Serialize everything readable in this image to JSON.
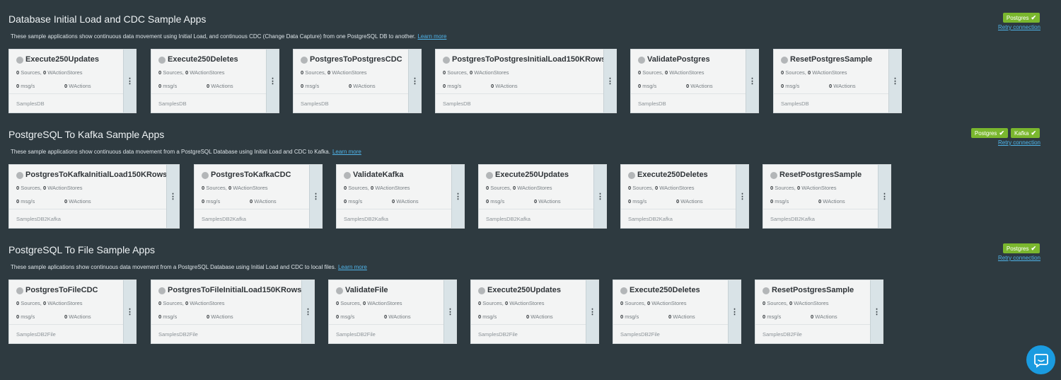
{
  "sections": [
    {
      "title": "Database Initial Load and CDC Sample Apps",
      "description": "These sample applications show continuous data movement using Initial Load, and continuous CDC (Change Data Capture) from one PostgreSQL DB to another.",
      "learn_more": "Learn more",
      "badges": [
        "Postgres"
      ],
      "retry": "Retry connection",
      "apps": [
        {
          "name": "Execute250Updates",
          "sources": "0",
          "sources_label": "Sources,",
          "stores": "0",
          "stores_label": "WActionStores",
          "msg": "0",
          "msg_label": "msg/s",
          "wactions": "0",
          "wactions_label": "WActions",
          "db": "SamplesDB"
        },
        {
          "name": "Execute250Deletes",
          "sources": "0",
          "sources_label": "Sources,",
          "stores": "0",
          "stores_label": "WActionStores",
          "msg": "0",
          "msg_label": "msg/s",
          "wactions": "0",
          "wactions_label": "WActions",
          "db": "SamplesDB"
        },
        {
          "name": "PostgresToPostgresCDC",
          "sources": "0",
          "sources_label": "Sources,",
          "stores": "0",
          "stores_label": "WActionStores",
          "msg": "0",
          "msg_label": "msg/s",
          "wactions": "0",
          "wactions_label": "WActions",
          "db": "SamplesDB"
        },
        {
          "name": "PostgresToPostgresInitialLoad150KRows",
          "sources": "0",
          "sources_label": "Sources,",
          "stores": "0",
          "stores_label": "WActionStores",
          "msg": "0",
          "msg_label": "msg/s",
          "wactions": "0",
          "wactions_label": "WActions",
          "db": "SamplesDB"
        },
        {
          "name": "ValidatePostgres",
          "sources": "0",
          "sources_label": "Sources,",
          "stores": "0",
          "stores_label": "WActionStores",
          "msg": "0",
          "msg_label": "msg/s",
          "wactions": "0",
          "wactions_label": "WActions",
          "db": "SamplesDB"
        },
        {
          "name": "ResetPostgresSample",
          "sources": "0",
          "sources_label": "Sources,",
          "stores": "0",
          "stores_label": "WActionStores",
          "msg": "0",
          "msg_label": "msg/s",
          "wactions": "0",
          "wactions_label": "WActions",
          "db": "SamplesDB"
        }
      ]
    },
    {
      "title": "PostgreSQL To Kafka Sample Apps",
      "description": "These sample applications show continuous data movement from a PostgreSQL Database using Initial Load and CDC to Kafka.",
      "learn_more": "Learn more",
      "badges": [
        "Postgres",
        "Kafka"
      ],
      "retry": "Retry connection",
      "apps": [
        {
          "name": "PostgresToKafkaInitialLoad150KRows",
          "sources": "0",
          "sources_label": "Sources,",
          "stores": "0",
          "stores_label": "WActionStores",
          "msg": "0",
          "msg_label": "msg/s",
          "wactions": "0",
          "wactions_label": "WActions",
          "db": "SamplesDB2Kafka"
        },
        {
          "name": "PostgresToKafkaCDC",
          "sources": "0",
          "sources_label": "Sources,",
          "stores": "0",
          "stores_label": "WActionStores",
          "msg": "0",
          "msg_label": "msg/s",
          "wactions": "0",
          "wactions_label": "WActions",
          "db": "SamplesDB2Kafka"
        },
        {
          "name": "ValidateKafka",
          "sources": "0",
          "sources_label": "Sources,",
          "stores": "0",
          "stores_label": "WActionStores",
          "msg": "0",
          "msg_label": "msg/s",
          "wactions": "0",
          "wactions_label": "WActions",
          "db": "SamplesDB2Kafka"
        },
        {
          "name": "Execute250Updates",
          "sources": "0",
          "sources_label": "Sources,",
          "stores": "0",
          "stores_label": "WActionStores",
          "msg": "0",
          "msg_label": "msg/s",
          "wactions": "0",
          "wactions_label": "WActions",
          "db": "SamplesDB2Kafka"
        },
        {
          "name": "Execute250Deletes",
          "sources": "0",
          "sources_label": "Sources,",
          "stores": "0",
          "stores_label": "WActionStores",
          "msg": "0",
          "msg_label": "msg/s",
          "wactions": "0",
          "wactions_label": "WActions",
          "db": "SamplesDB2Kafka"
        },
        {
          "name": "ResetPostgresSample",
          "sources": "0",
          "sources_label": "Sources,",
          "stores": "0",
          "stores_label": "WActionStores",
          "msg": "0",
          "msg_label": "msg/s",
          "wactions": "0",
          "wactions_label": "WActions",
          "db": "SamplesDB2Kafka"
        }
      ]
    },
    {
      "title": "PostgreSQL To File Sample Apps",
      "description": "These sample aplications show continuous data movement from a PostgreSQL Database using Initial Load and CDC to local files.",
      "learn_more": "Learn more",
      "badges": [
        "Postgres"
      ],
      "retry": "Retry connection",
      "apps": [
        {
          "name": "PostgresToFileCDC",
          "sources": "0",
          "sources_label": "Sources,",
          "stores": "0",
          "stores_label": "WActionStores",
          "msg": "0",
          "msg_label": "msg/s",
          "wactions": "0",
          "wactions_label": "WActions",
          "db": "SamplesDB2File"
        },
        {
          "name": "PostgresToFileInitialLoad150KRows",
          "sources": "0",
          "sources_label": "Sources,",
          "stores": "0",
          "stores_label": "WActionStores",
          "msg": "0",
          "msg_label": "msg/s",
          "wactions": "0",
          "wactions_label": "WActions",
          "db": "SamplesDB2File"
        },
        {
          "name": "ValidateFile",
          "sources": "0",
          "sources_label": "Sources,",
          "stores": "0",
          "stores_label": "WActionStores",
          "msg": "0",
          "msg_label": "msg/s",
          "wactions": "0",
          "wactions_label": "WActions",
          "db": "SamplesDB2File"
        },
        {
          "name": "Execute250Updates",
          "sources": "0",
          "sources_label": "Sources,",
          "stores": "0",
          "stores_label": "WActionStores",
          "msg": "0",
          "msg_label": "msg/s",
          "wactions": "0",
          "wactions_label": "WActions",
          "db": "SamplesDB2File"
        },
        {
          "name": "Execute250Deletes",
          "sources": "0",
          "sources_label": "Sources,",
          "stores": "0",
          "stores_label": "WActionStores",
          "msg": "0",
          "msg_label": "msg/s",
          "wactions": "0",
          "wactions_label": "WActions",
          "db": "SamplesDB2File"
        },
        {
          "name": "ResetPostgresSample",
          "sources": "0",
          "sources_label": "Sources,",
          "stores": "0",
          "stores_label": "WActionStores",
          "msg": "0",
          "msg_label": "msg/s",
          "wactions": "0",
          "wactions_label": "WActions",
          "db": "SamplesDB2File"
        }
      ]
    }
  ],
  "icons": {
    "status": "status-dot-icon",
    "menu": "kebab-menu-icon",
    "badge_check": "check-icon",
    "chat": "chat-bubble-icon"
  },
  "colors": {
    "background": "#2e3a40",
    "badge": "#7ab72e",
    "link": "#4fb3e8",
    "chat": "#1a9be0",
    "card": "#f3f4f4"
  }
}
